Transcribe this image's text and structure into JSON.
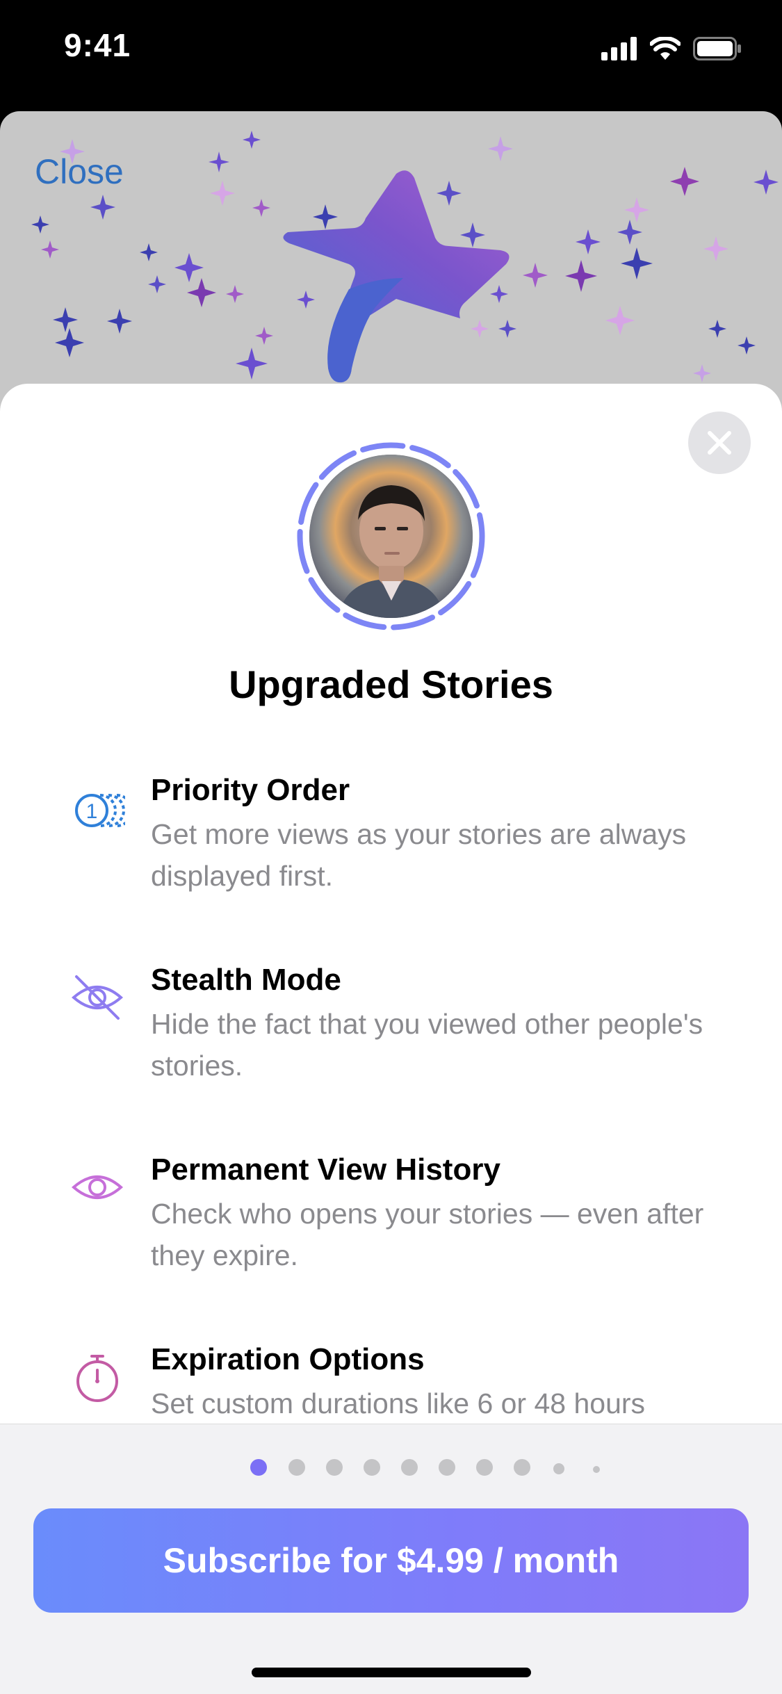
{
  "status_bar": {
    "time": "9:41"
  },
  "background_sheet": {
    "close_label": "Close"
  },
  "sheet": {
    "title": "Upgraded Stories",
    "features": [
      {
        "icon": "priority-order-icon",
        "title": "Priority Order",
        "description": "Get more views as your stories are always displayed first."
      },
      {
        "icon": "stealth-mode-icon",
        "title": "Stealth Mode",
        "description": "Hide the fact that you viewed other people's stories."
      },
      {
        "icon": "view-history-icon",
        "title": "Permanent View History",
        "description": "Check who opens your stories — even after they expire."
      },
      {
        "icon": "stopwatch-icon",
        "title": "Expiration Options",
        "description": "Set custom durations like 6 or 48 hours"
      }
    ]
  },
  "pagination": {
    "total": 10,
    "active_index": 0
  },
  "subscribe_label": "Subscribe for $4.99 / month",
  "colors": {
    "accent": "#7b7cf9",
    "link": "#2f6fbf",
    "icon_blue": "#2f80d9",
    "icon_purple": "#8e7cf0",
    "icon_pink": "#c66fd9",
    "icon_magenta": "#c35ba4"
  }
}
